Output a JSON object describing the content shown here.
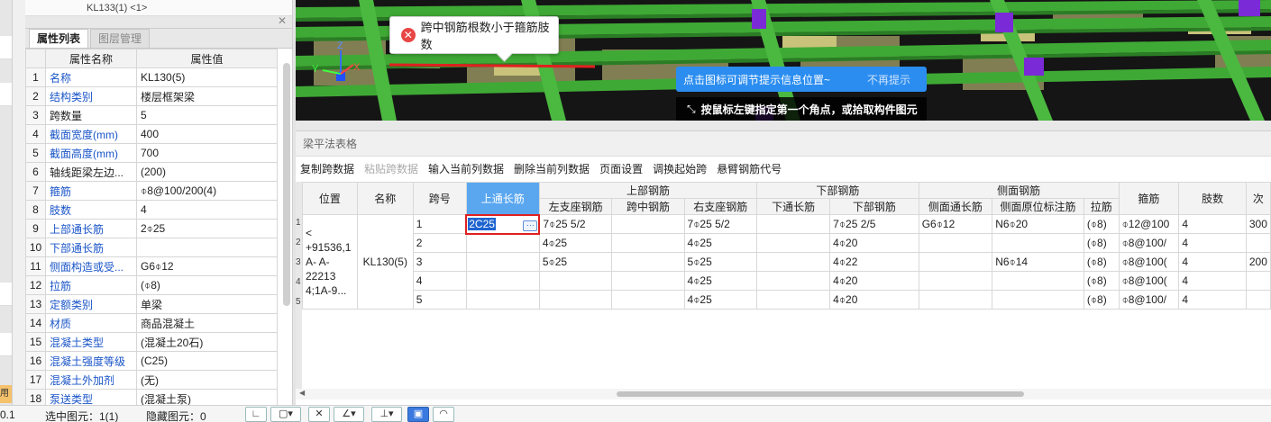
{
  "tree": {
    "top_item": "KL133(1) <1>"
  },
  "prop_panel": {
    "tabs": [
      "属性列表",
      "图层管理"
    ],
    "active_tab": 0,
    "columns": [
      "属性名称",
      "属性值"
    ],
    "rows": [
      {
        "idx": "1",
        "name": "名称",
        "value": "KL130(5)",
        "blue": true
      },
      {
        "idx": "2",
        "name": "结构类别",
        "value": "楼层框架梁",
        "blue": true
      },
      {
        "idx": "3",
        "name": "跨数量",
        "value": "5",
        "blue": false
      },
      {
        "idx": "4",
        "name": "截面宽度(mm)",
        "value": "400",
        "blue": true
      },
      {
        "idx": "5",
        "name": "截面高度(mm)",
        "value": "700",
        "blue": true
      },
      {
        "idx": "6",
        "name": "轴线距梁左边...",
        "value": "(200)",
        "blue": false
      },
      {
        "idx": "7",
        "name": "箍筋",
        "value": "⌽8@100/200(4)",
        "blue": true
      },
      {
        "idx": "8",
        "name": "肢数",
        "value": "4",
        "blue": true
      },
      {
        "idx": "9",
        "name": "上部通长筋",
        "value": "2⌽25",
        "blue": true
      },
      {
        "idx": "10",
        "name": "下部通长筋",
        "value": "",
        "blue": true
      },
      {
        "idx": "11",
        "name": "侧面构造或受...",
        "value": "G6⌽12",
        "blue": true
      },
      {
        "idx": "12",
        "name": "拉筋",
        "value": "(⌽8)",
        "blue": true
      },
      {
        "idx": "13",
        "name": "定额类别",
        "value": "单梁",
        "blue": true
      },
      {
        "idx": "14",
        "name": "材质",
        "value": "商品混凝土",
        "blue": true
      },
      {
        "idx": "15",
        "name": "混凝土类型",
        "value": "(混凝土20石)",
        "blue": true
      },
      {
        "idx": "16",
        "name": "混凝土强度等级",
        "value": "(C25)",
        "blue": true
      },
      {
        "idx": "17",
        "name": "混凝土外加剂",
        "value": "(无)",
        "blue": true
      },
      {
        "idx": "18",
        "name": "泵送类型",
        "value": "(混凝土泵)",
        "blue": true
      }
    ]
  },
  "left_strip": {
    "tag": "用"
  },
  "viewport": {
    "axis_labels": {
      "z": "Z",
      "y": "Y",
      "x": "X"
    },
    "error_tip": "跨中钢筋根数小于箍筋肢数",
    "info_tip": "点击图标可调节提示信息位置~",
    "info_dismiss": "不再提示",
    "hint": "按鼠标左键指定第一个角点，或拾取构件图元"
  },
  "beam_panel": {
    "title": "梁平法表格",
    "toolbar": [
      {
        "label": "复制跨数据",
        "disabled": false
      },
      {
        "label": "粘贴跨数据",
        "disabled": true
      },
      {
        "label": "输入当前列数据",
        "disabled": false
      },
      {
        "label": "删除当前列数据",
        "disabled": false
      },
      {
        "label": "页面设置",
        "disabled": false
      },
      {
        "label": "调换起始跨",
        "disabled": false
      },
      {
        "label": "悬臂钢筋代号",
        "disabled": false
      }
    ],
    "headers": {
      "pos": "位置",
      "name": "名称",
      "span": "跨号",
      "top_through": "上通长筋",
      "group_top": "上部钢筋",
      "group_bottom": "下部钢筋",
      "group_side": "侧面钢筋",
      "left_support": "左支座钢筋",
      "mid_span": "跨中钢筋",
      "right_support": "右支座钢筋",
      "bottom_through": "下通长筋",
      "bottom_bar": "下部钢筋",
      "side_through": "侧面通长筋",
      "side_local": "侧面原位标注筋",
      "tie": "拉筋",
      "stirrup": "箍筋",
      "legs": "肢数",
      "extra": "次"
    },
    "position_text": "< +91536,1 A- A-22213 4;1A-9...",
    "name_text": "KL130(5)",
    "current_value": "2C25",
    "rows": [
      {
        "span": "1",
        "top_through": "",
        "left": "7⌽25 5/2",
        "mid": "",
        "right": "7⌽25 5/2",
        "bthrough": "",
        "bottom": "7⌽25 2/5",
        "sthrough": "G6⌽12",
        "slocal": "N6⌽20",
        "tie": "(⌽8)",
        "stirrup": "⌽12@100",
        "legs": "4",
        "extra": "300"
      },
      {
        "span": "2",
        "top_through": "",
        "left": "4⌽25",
        "mid": "",
        "right": "4⌽25",
        "bthrough": "",
        "bottom": "4⌽20",
        "sthrough": "",
        "slocal": "",
        "tie": "(⌽8)",
        "stirrup": "⌽8@100/",
        "legs": "4",
        "extra": ""
      },
      {
        "span": "3",
        "top_through": "",
        "left": "5⌽25",
        "mid": "",
        "right": "5⌽25",
        "bthrough": "",
        "bottom": "4⌽22",
        "sthrough": "",
        "slocal": "N6⌽14",
        "tie": "(⌽8)",
        "stirrup": "⌽8@100(",
        "legs": "4",
        "extra": "200"
      },
      {
        "span": "4",
        "top_through": "",
        "left": "",
        "mid": "",
        "right": "4⌽25",
        "bthrough": "",
        "bottom": "4⌽20",
        "sthrough": "",
        "slocal": "",
        "tie": "(⌽8)",
        "stirrup": "⌽8@100(",
        "legs": "4",
        "extra": ""
      },
      {
        "span": "5",
        "top_through": "",
        "left": "",
        "mid": "",
        "right": "4⌽25",
        "bthrough": "",
        "bottom": "4⌽20",
        "sthrough": "",
        "slocal": "",
        "tie": "(⌽8)",
        "stirrup": "⌽8@100/",
        "legs": "4",
        "extra": ""
      }
    ],
    "row_header_numbers": [
      "1",
      "2",
      "3",
      "4",
      "5"
    ]
  },
  "status": {
    "left_value": "0.1",
    "selected": "选中图元：1(1)",
    "hidden": "隐藏图元：0"
  },
  "colors": {
    "accent": "#5aa7f0",
    "error": "#e84545",
    "info": "#2b8df0",
    "beam_green": "#3fa935",
    "link_blue": "#1a55c8"
  }
}
